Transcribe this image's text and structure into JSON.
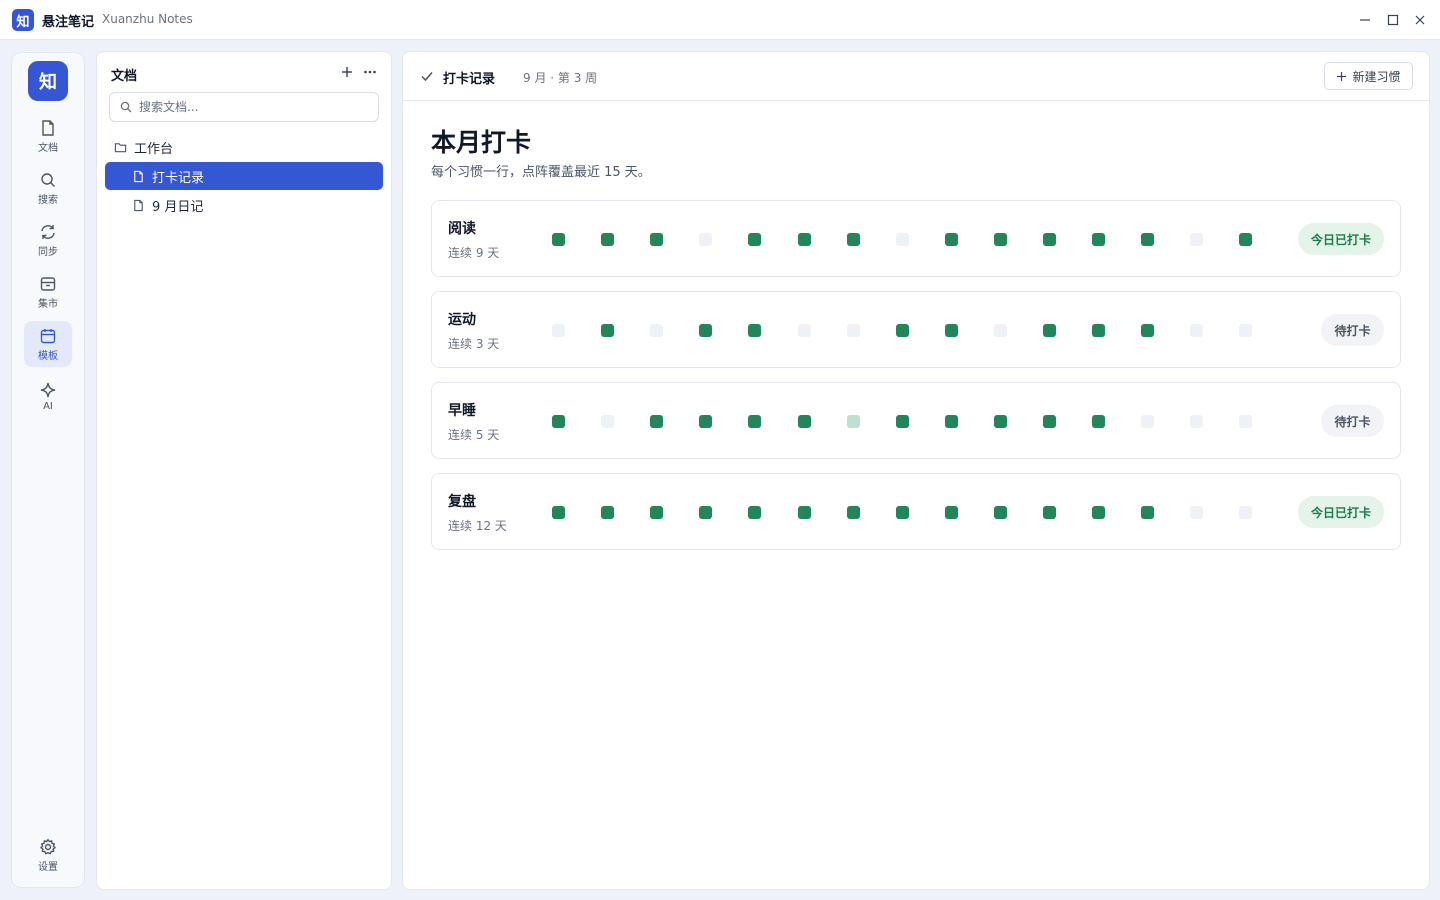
{
  "titlebar": {
    "logo_char": "知",
    "app_name": "悬注笔记",
    "app_subtitle": "Xuanzhu Notes"
  },
  "rail": {
    "logo_char": "知",
    "items": [
      {
        "label": "文档",
        "icon": "document-icon"
      },
      {
        "label": "搜索",
        "icon": "search-icon"
      },
      {
        "label": "同步",
        "icon": "sync-icon"
      },
      {
        "label": "集市",
        "icon": "archive-icon"
      },
      {
        "label": "模板",
        "icon": "calendar-icon",
        "active": true
      },
      {
        "label": "AI",
        "icon": "sparkle-icon"
      }
    ],
    "settings_label": "设置"
  },
  "doc_panel": {
    "title": "文档",
    "search_placeholder": "搜索文档...",
    "folder": "工作台",
    "docs": [
      {
        "label": "打卡记录",
        "active": true
      },
      {
        "label": "9 月日记",
        "active": false
      }
    ]
  },
  "main": {
    "header_title": "打卡记录",
    "header_crumb": "9 月 · 第 3 周",
    "new_button": "新建习惯",
    "page_title": "本月打卡",
    "page_subtitle": "每个习惯一行，点阵覆盖最近 15 天。"
  },
  "habits": [
    {
      "name": "阅读",
      "streak": "连续 9 天",
      "action": "今日已打卡",
      "checked": true,
      "days": [
        1,
        1,
        1,
        0,
        1,
        1,
        1,
        0,
        1,
        1,
        1,
        1,
        1,
        0,
        1
      ]
    },
    {
      "name": "运动",
      "streak": "连续 3 天",
      "action": "待打卡",
      "checked": false,
      "days": [
        0,
        1,
        0,
        1,
        1,
        0,
        0,
        1,
        1,
        0,
        1,
        1,
        1,
        0,
        0
      ]
    },
    {
      "name": "早睡",
      "streak": "连续 5 天",
      "action": "待打卡",
      "checked": false,
      "days": [
        1,
        0,
        1,
        1,
        1,
        1,
        0.5,
        1,
        1,
        1,
        1,
        1,
        0,
        0,
        0
      ]
    },
    {
      "name": "复盘",
      "streak": "连续 12 天",
      "action": "今日已打卡",
      "checked": true,
      "days": [
        1,
        1,
        1,
        1,
        1,
        1,
        1,
        1,
        1,
        1,
        1,
        1,
        1,
        0,
        0
      ]
    }
  ],
  "colors": {
    "accent": "#3557d4",
    "done": "#23855a",
    "partial": "#bfe0cf",
    "empty": "#eef1f6",
    "checked_badge_bg": "#e4f4ea",
    "checked_badge_text": "#1f7a4d"
  }
}
